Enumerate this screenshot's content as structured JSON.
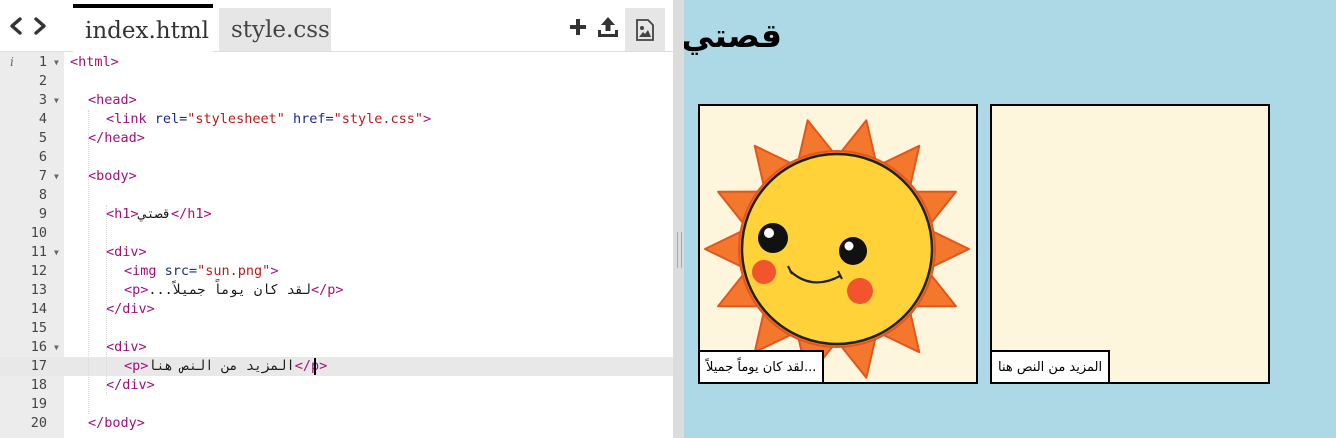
{
  "editor": {
    "tabs": [
      {
        "label": "index.html",
        "active": true
      },
      {
        "label": "style.css",
        "active": false
      }
    ],
    "toolbar": {
      "back_icon": "chevron-left-icon",
      "forward_icon": "chevron-right-icon",
      "add_icon": "plus-icon",
      "upload_icon": "upload-icon",
      "image_icon": "image-icon"
    },
    "info_icon": "i",
    "current_line": 17,
    "lines": [
      {
        "n": "1",
        "fold": true,
        "indent": 0,
        "parts": [
          [
            "tag",
            "<html>"
          ]
        ]
      },
      {
        "n": "2",
        "fold": false,
        "indent": 0,
        "parts": []
      },
      {
        "n": "3",
        "fold": true,
        "indent": 1,
        "parts": [
          [
            "tag",
            "<head>"
          ]
        ]
      },
      {
        "n": "4",
        "fold": false,
        "indent": 2,
        "parts": [
          [
            "tag",
            "<link "
          ],
          [
            "attr",
            "rel="
          ],
          [
            "str",
            "\"stylesheet\""
          ],
          [
            "attr",
            " href="
          ],
          [
            "str",
            "\"style.css\""
          ],
          [
            "tag",
            ">"
          ]
        ]
      },
      {
        "n": "5",
        "fold": false,
        "indent": 1,
        "parts": [
          [
            "tag",
            "</head>"
          ]
        ]
      },
      {
        "n": "6",
        "fold": false,
        "indent": 0,
        "parts": []
      },
      {
        "n": "7",
        "fold": true,
        "indent": 1,
        "parts": [
          [
            "tag",
            "<body>"
          ]
        ]
      },
      {
        "n": "8",
        "fold": false,
        "indent": 0,
        "parts": []
      },
      {
        "n": "9",
        "fold": false,
        "indent": 2,
        "parts": [
          [
            "tag",
            "<h1>"
          ],
          [
            "text",
            "قصتي"
          ],
          [
            "tag",
            "</h1>"
          ]
        ]
      },
      {
        "n": "10",
        "fold": false,
        "indent": 0,
        "parts": []
      },
      {
        "n": "11",
        "fold": true,
        "indent": 2,
        "parts": [
          [
            "tag",
            "<div>"
          ]
        ]
      },
      {
        "n": "12",
        "fold": false,
        "indent": 3,
        "parts": [
          [
            "tag",
            "<img "
          ],
          [
            "attr",
            "src="
          ],
          [
            "str",
            "\"sun.png\""
          ],
          [
            "tag",
            ">"
          ]
        ]
      },
      {
        "n": "13",
        "fold": false,
        "indent": 3,
        "parts": [
          [
            "tag",
            "<p>"
          ],
          [
            "text",
            "...لقد كان يوماً جميلاً"
          ],
          [
            "tag",
            "</p>"
          ]
        ]
      },
      {
        "n": "14",
        "fold": false,
        "indent": 2,
        "parts": [
          [
            "tag",
            "</div>"
          ]
        ]
      },
      {
        "n": "15",
        "fold": false,
        "indent": 0,
        "parts": []
      },
      {
        "n": "16",
        "fold": true,
        "indent": 2,
        "parts": [
          [
            "tag",
            "<div>"
          ]
        ]
      },
      {
        "n": "17",
        "fold": false,
        "indent": 3,
        "parts": [
          [
            "tag",
            "<p>"
          ],
          [
            "text",
            "المزيد من النص هنا"
          ],
          [
            "tag",
            "</p>"
          ]
        ]
      },
      {
        "n": "18",
        "fold": false,
        "indent": 2,
        "parts": [
          [
            "tag",
            "</div>"
          ]
        ]
      },
      {
        "n": "19",
        "fold": false,
        "indent": 0,
        "parts": []
      },
      {
        "n": "20",
        "fold": false,
        "indent": 1,
        "parts": [
          [
            "tag",
            "</body>"
          ]
        ]
      }
    ]
  },
  "preview": {
    "heading": "قصتي",
    "panels": [
      {
        "caption": "...لقد كان يوماً جميلاً",
        "image": "sun-image"
      },
      {
        "caption": "المزيد من النص هنا"
      }
    ]
  },
  "colors": {
    "preview_bg": "#add8e6",
    "panel_bg": "#fdf5dc",
    "tag": "#a0107a",
    "attr": "#1f2a8a",
    "string": "#b71c1c"
  }
}
